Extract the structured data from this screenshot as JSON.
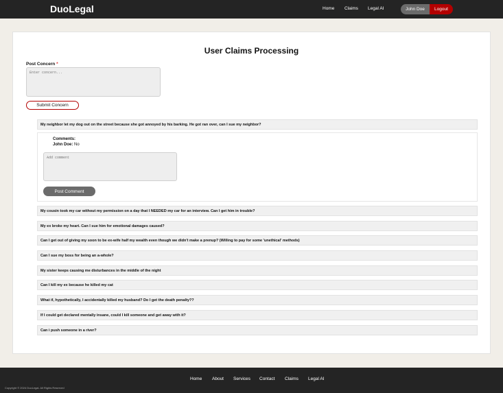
{
  "header": {
    "brand": "DuoLegal",
    "nav": [
      "Home",
      "Claims",
      "Legal AI"
    ],
    "user_name": "John Doe",
    "logout_label": "Logout"
  },
  "main": {
    "title": "User Claims Processing",
    "post_label": "Post Concern",
    "post_required_mark": "*",
    "concern_placeholder": "Enter concern...",
    "submit_label": "Submit Concern",
    "expanded_claim": {
      "text": "My neighbor let my dog out on the street because she got annoyed by his barking. He got ran over, can I sue my neighbor?",
      "comments_label": "Comments:",
      "comments": [
        {
          "author": "John Doe:",
          "text": "No"
        }
      ],
      "comment_placeholder": "Add comment",
      "post_comment_label": "Post Comment"
    },
    "claims": [
      "My cousin took my car without my permission on a day that I NEEDED my car for an interview. Can I get him in trouble?",
      "My ex broke my heart. Can I sue him for emotional damages caused?",
      "Can I get out of giving my soon to be ex-wife half my wealth even though we didn't make a prenup? (Willing to pay for some 'unethical' methods)",
      "Can I sue my boss for being an a-whole?",
      "My sister keeps causing me disturbances in the middle of the night",
      "Can I kill my ex because he killed my cat",
      "What if, hypothetically, I accidentally killed my husband? Do I get the death penalty??",
      "If I could get declared mentally insane, could I kill someone and get away with it?",
      "Can i push someone in a river?"
    ]
  },
  "footer": {
    "nav": [
      "Home",
      "About",
      "Services",
      "Contact",
      "Claims",
      "Legal AI"
    ],
    "copyright": "Copyright © 2024 DuoLegal. All Rights Reserved"
  },
  "colors": {
    "header_bg": "#242424",
    "accent_red": "#b30000",
    "pill_gray": "#6b6b6b",
    "page_bg": "#f1eee8"
  }
}
